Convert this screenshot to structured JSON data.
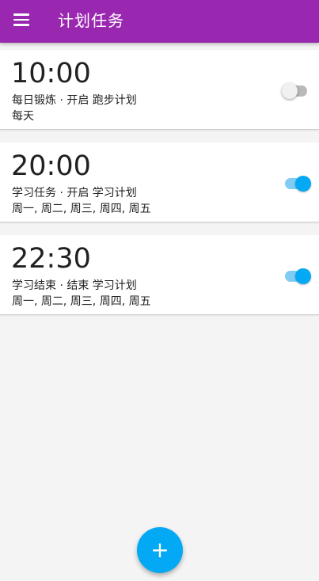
{
  "app_bar": {
    "title": "计划任务",
    "color": "#9a27b0",
    "menu_icon": "menu-icon"
  },
  "tasks": [
    {
      "time": "10:00",
      "description": "每日锻炼 · 开启 跑步计划",
      "repeat": "每天",
      "enabled": false
    },
    {
      "time": "20:00",
      "description": "学习任务 · 开启 学习计划",
      "repeat": "周一, 周二, 周三, 周四, 周五",
      "enabled": true
    },
    {
      "time": "22:30",
      "description": "学习结束 · 结束 学习计划",
      "repeat": "周一, 周二, 周三, 周四, 周五",
      "enabled": true
    }
  ],
  "fab": {
    "label": "+",
    "icon": "add-icon",
    "color": "#03a9f4"
  }
}
